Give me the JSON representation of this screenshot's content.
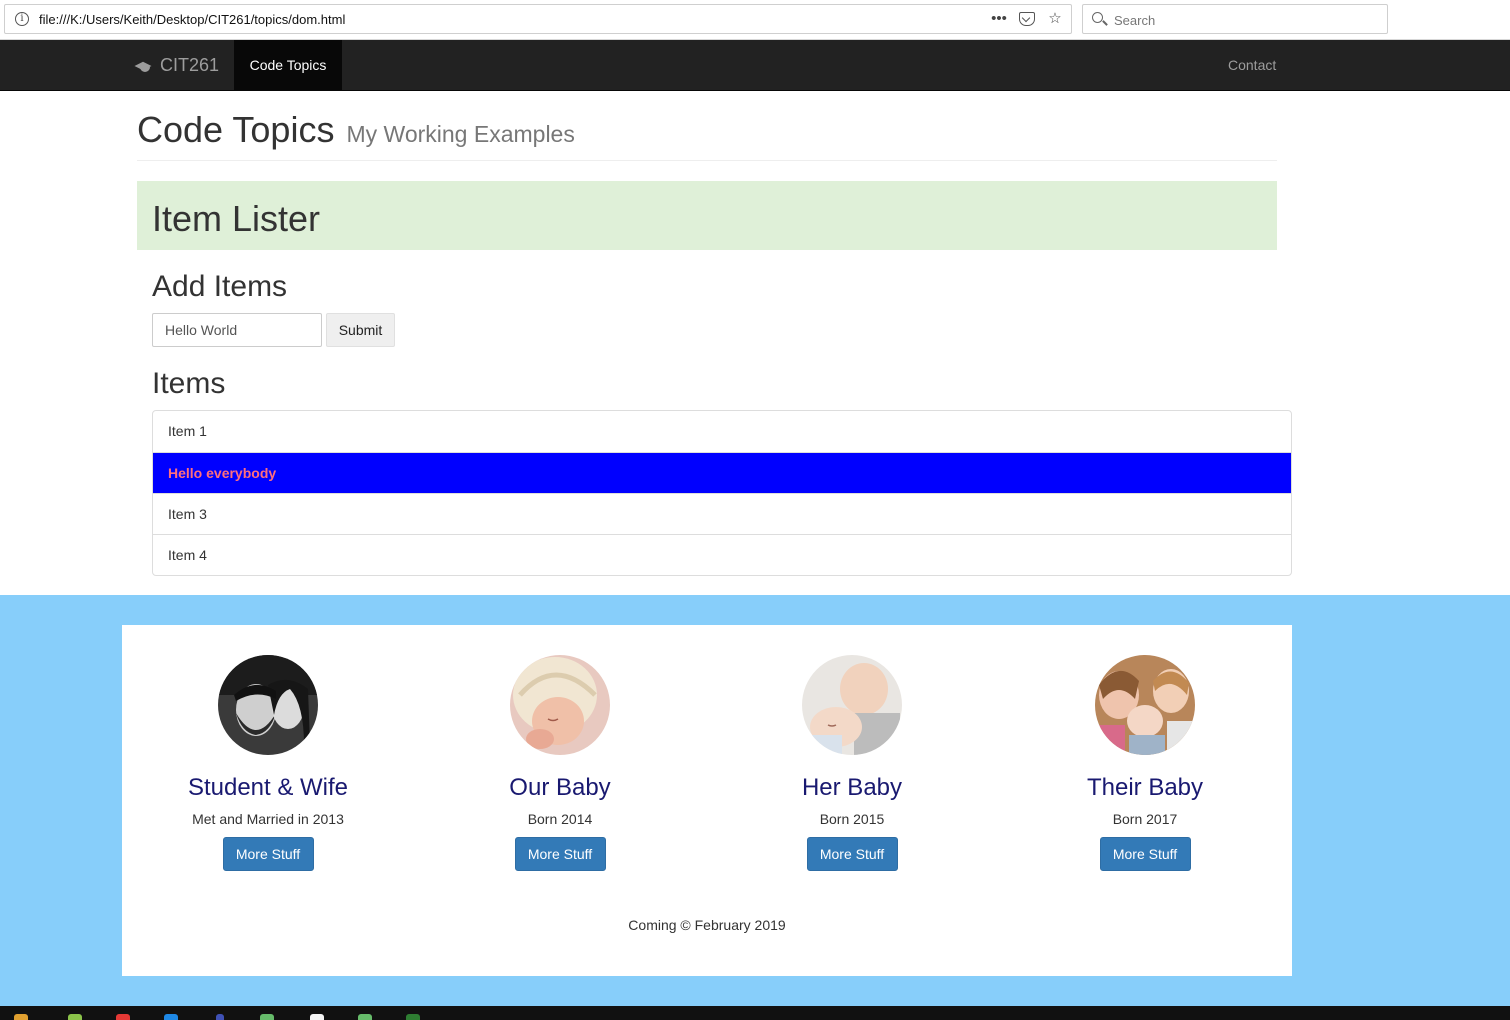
{
  "browser": {
    "url": "file:///K:/Users/Keith/Desktop/CIT261/topics/dom.html",
    "search_placeholder": "Search"
  },
  "navbar": {
    "brand": "CIT261",
    "active_item": "Code Topics",
    "contact": "Contact"
  },
  "header": {
    "title": "Code Topics",
    "subtitle": "My Working Examples"
  },
  "jumbotron": {
    "title": "Item Lister"
  },
  "add_items": {
    "heading": "Add Items",
    "input_value": "Hello World",
    "submit_label": "Submit"
  },
  "items": {
    "heading": "Items",
    "list": [
      "Item 1",
      "Hello everybody",
      "Item 3",
      "Item 4"
    ],
    "highlight_index": 1
  },
  "cards": [
    {
      "title": "Student & Wife",
      "text": "Met and Married in 2013",
      "button": "More Stuff"
    },
    {
      "title": "Our Baby",
      "text": "Born 2014",
      "button": "More Stuff"
    },
    {
      "title": "Her Baby",
      "text": "Born 2015",
      "button": "More Stuff"
    },
    {
      "title": "Their Baby",
      "text": "Born 2017",
      "button": "More Stuff"
    }
  ],
  "footer": {
    "copyright": "Coming © February 2019"
  },
  "colors": {
    "navbar": "#222222",
    "jumbotron": "#dff0d8",
    "highlight_bg": "#0000ff",
    "highlight_text": "#ff6f7d",
    "band": "#87cefa",
    "card_title": "#191970",
    "button": "#337ab7"
  }
}
